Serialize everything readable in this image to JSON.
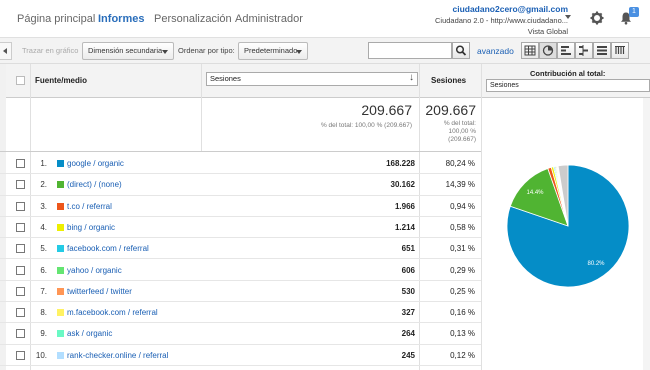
{
  "nav": {
    "tabs": [
      {
        "label": "Página principal",
        "active": false
      },
      {
        "label": "Informes",
        "active": true
      },
      {
        "label": "Personalización",
        "active": false
      },
      {
        "label": "Administrador",
        "active": false
      }
    ],
    "account": {
      "email": "ciudadano2cero@gmail.com",
      "property": "Ciudadano 2.0 - http://www.ciudadano...",
      "view": "Vista Global"
    },
    "notification_count": "1",
    "icons": [
      "gear-icon",
      "bell-icon",
      "chevron-down-icon"
    ]
  },
  "toolbar": {
    "plot_rows_label": "Trazar en gráfico",
    "secondary_dimension": "Dimensión secundaria",
    "sort_label": "Ordenar por tipo:",
    "sort_value": "Predeterminado",
    "search_value": "",
    "advanced_label": "avanzado"
  },
  "table": {
    "header": {
      "dimension": "Fuente/medio",
      "metric_select": "Sesiones",
      "metric": "Sesiones",
      "contribution": "Contribución al total:",
      "contribution_select": "Sesiones"
    },
    "totals": {
      "value": "209.667",
      "value_note": "% del total: 100,00 % (209.667)",
      "metric_value": "209.667",
      "metric_note_1": "% del total:",
      "metric_note_2": "100,00 %",
      "metric_note_3": "(209.667)"
    },
    "rows": [
      {
        "n": "1.",
        "source": "google / organic",
        "value": "168.228",
        "pct": "80,24 %",
        "color": "#058dc7"
      },
      {
        "n": "2.",
        "source": "(direct) / (none)",
        "value": "30.162",
        "pct": "14,39 %",
        "color": "#50b432"
      },
      {
        "n": "3.",
        "source": "t.co / referral",
        "value": "1.966",
        "pct": "0,94 %",
        "color": "#ed561b"
      },
      {
        "n": "4.",
        "source": "bing / organic",
        "value": "1.214",
        "pct": "0,58 %",
        "color": "#edef00"
      },
      {
        "n": "5.",
        "source": "facebook.com / referral",
        "value": "651",
        "pct": "0,31 %",
        "color": "#24cbe5"
      },
      {
        "n": "6.",
        "source": "yahoo / organic",
        "value": "606",
        "pct": "0,29 %",
        "color": "#64e572"
      },
      {
        "n": "7.",
        "source": "twitterfeed / twitter",
        "value": "530",
        "pct": "0,25 %",
        "color": "#ff9655"
      },
      {
        "n": "8.",
        "source": "m.facebook.com / referral",
        "value": "327",
        "pct": "0,16 %",
        "color": "#fff263"
      },
      {
        "n": "9.",
        "source": "ask / organic",
        "value": "264",
        "pct": "0,13 %",
        "color": "#6af9c4"
      },
      {
        "n": "10.",
        "source": "rank-checker.online / referral",
        "value": "245",
        "pct": "0,12 %",
        "color": "#b2deff"
      }
    ]
  },
  "pie": {
    "label_big": "80.2%",
    "label_second": "14.4%",
    "other_color": "#cccccc"
  }
}
